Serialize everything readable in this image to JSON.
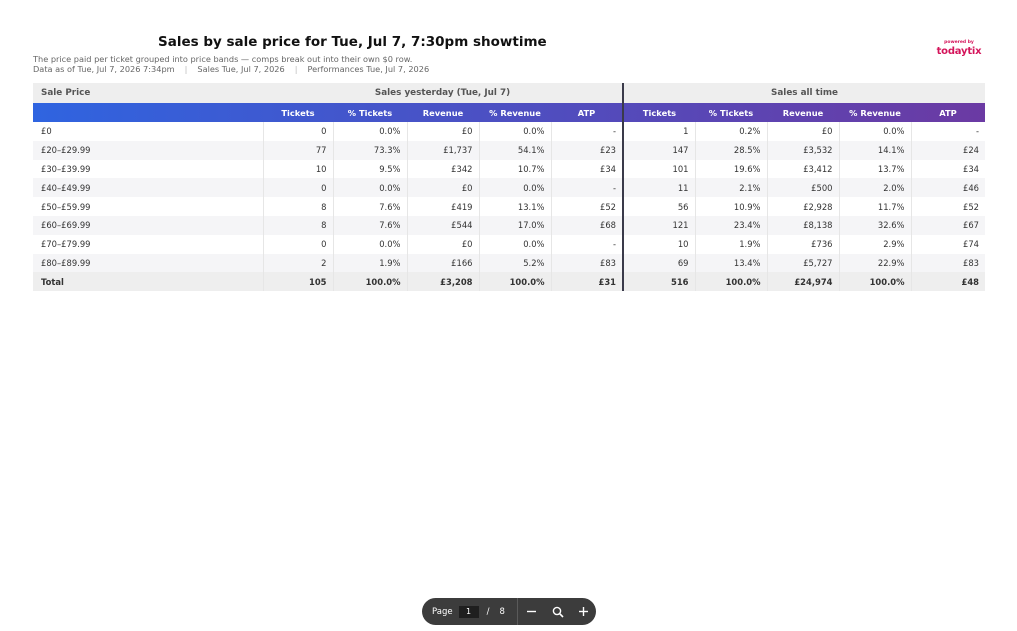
{
  "header": {
    "title": "Sales by sale price for Tue, Jul 7, 7:30pm showtime",
    "subtitle": "The price paid per ticket grouped into price bands — comps break out into their own $0 row.",
    "data_as_of": "Data as of Tue, Jul 7, 2026 7:34pm",
    "sales_date": "Sales Tue, Jul 7, 2026",
    "performances_date": "Performances Tue, Jul 7, 2026"
  },
  "brand": {
    "powered_by": "powered by",
    "name": "todaytix",
    "color": "#d4145a"
  },
  "table": {
    "first_header": "Sale Price",
    "group_yesterday": "Sales yesterday (Tue, Jul 7)",
    "group_alltime": "Sales all time",
    "columns": [
      "Tickets",
      "% Tickets",
      "Revenue",
      "% Revenue",
      "ATP"
    ],
    "gradient_start": "#2f64e0",
    "gradient_end": "#6b3aa3",
    "rows": [
      {
        "band": "£0",
        "y": [
          "0",
          "0.0%",
          "£0",
          "0.0%",
          "-"
        ],
        "a": [
          "1",
          "0.2%",
          "£0",
          "0.0%",
          "-"
        ]
      },
      {
        "band": "£20–£29.99",
        "y": [
          "77",
          "73.3%",
          "£1,737",
          "54.1%",
          "£23"
        ],
        "a": [
          "147",
          "28.5%",
          "£3,532",
          "14.1%",
          "£24"
        ]
      },
      {
        "band": "£30–£39.99",
        "y": [
          "10",
          "9.5%",
          "£342",
          "10.7%",
          "£34"
        ],
        "a": [
          "101",
          "19.6%",
          "£3,412",
          "13.7%",
          "£34"
        ]
      },
      {
        "band": "£40–£49.99",
        "y": [
          "0",
          "0.0%",
          "£0",
          "0.0%",
          "-"
        ],
        "a": [
          "11",
          "2.1%",
          "£500",
          "2.0%",
          "£46"
        ]
      },
      {
        "band": "£50–£59.99",
        "y": [
          "8",
          "7.6%",
          "£419",
          "13.1%",
          "£52"
        ],
        "a": [
          "56",
          "10.9%",
          "£2,928",
          "11.7%",
          "£52"
        ]
      },
      {
        "band": "£60–£69.99",
        "y": [
          "8",
          "7.6%",
          "£544",
          "17.0%",
          "£68"
        ],
        "a": [
          "121",
          "23.4%",
          "£8,138",
          "32.6%",
          "£67"
        ]
      },
      {
        "band": "£70–£79.99",
        "y": [
          "0",
          "0.0%",
          "£0",
          "0.0%",
          "-"
        ],
        "a": [
          "10",
          "1.9%",
          "£736",
          "2.9%",
          "£74"
        ]
      },
      {
        "band": "£80–£89.99",
        "y": [
          "2",
          "1.9%",
          "£166",
          "5.2%",
          "£83"
        ],
        "a": [
          "69",
          "13.4%",
          "£5,727",
          "22.9%",
          "£83"
        ]
      }
    ],
    "total": {
      "band": "Total",
      "y": [
        "105",
        "100.0%",
        "£3,208",
        "100.0%",
        "£31"
      ],
      "a": [
        "516",
        "100.0%",
        "£24,974",
        "100.0%",
        "£48"
      ]
    }
  },
  "pager": {
    "label": "Page",
    "current": "1",
    "separator": "/",
    "total": "8"
  }
}
